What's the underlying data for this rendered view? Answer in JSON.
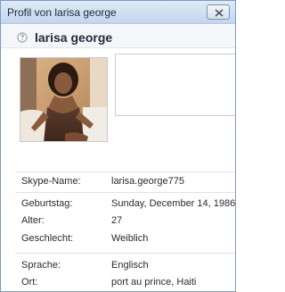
{
  "window": {
    "title": "Profil von larisa george"
  },
  "profile": {
    "display_name": "larisa george",
    "status_icon": "offline-status-icon",
    "mood_message": ""
  },
  "fields": {
    "skype_name": {
      "label": "Skype-Name:",
      "value": "larisa.george775"
    },
    "birthday": {
      "label": "Geburtstag:",
      "value": "Sunday, December 14, 1986"
    },
    "age": {
      "label": "Alter:",
      "value": "27"
    },
    "gender": {
      "label": "Geschlecht:",
      "value": "Weiblich"
    },
    "language": {
      "label": "Sprache:",
      "value": "Englisch"
    },
    "location": {
      "label": "Ort:",
      "value": "port au prince, Haiti"
    }
  },
  "colors": {
    "titlebar": "#cfdff1",
    "header_bg": "#f4f6f9",
    "window_border": "#7a9cc4"
  }
}
